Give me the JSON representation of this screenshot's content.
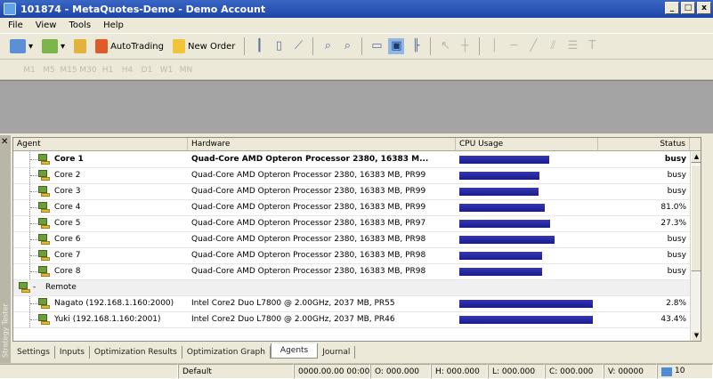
{
  "window": {
    "title": "101874 - MetaQuotes-Demo - Demo Account",
    "buttons": [
      "_",
      "□",
      "x"
    ]
  },
  "menu": [
    "File",
    "View",
    "Tools",
    "Help"
  ],
  "toolbar": {
    "autotrading_label": "AutoTrading",
    "new_order_label": "New Order"
  },
  "timeframes": [
    "M1",
    "M5",
    "M15",
    "M30",
    "H1",
    "H4",
    "D1",
    "W1",
    "MN"
  ],
  "tester": {
    "side_label": "Strategy Tester",
    "columns": {
      "agent": "Agent",
      "hardware": "Hardware",
      "cpu": "CPU Usage",
      "status": "Status"
    },
    "rows": [
      {
        "agent": "Core 1",
        "hardware": "Quad-Core AMD Opteron Processor 2380, 16383 M...",
        "cpu": 0.67,
        "status": "busy",
        "bold": true
      },
      {
        "agent": "Core 2",
        "hardware": "Quad-Core AMD Opteron Processor 2380, 16383 MB, PR99",
        "cpu": 0.6,
        "status": "busy"
      },
      {
        "agent": "Core 3",
        "hardware": "Quad-Core AMD Opteron Processor 2380, 16383 MB, PR99",
        "cpu": 0.59,
        "status": "busy"
      },
      {
        "agent": "Core 4",
        "hardware": "Quad-Core AMD Opteron Processor 2380, 16383 MB, PR99",
        "cpu": 0.64,
        "status": "81.0%"
      },
      {
        "agent": "Core 5",
        "hardware": "Quad-Core AMD Opteron Processor 2380, 16383 MB, PR97",
        "cpu": 0.68,
        "status": "27.3%"
      },
      {
        "agent": "Core 6",
        "hardware": "Quad-Core AMD Opteron Processor 2380, 16383 MB, PR98",
        "cpu": 0.71,
        "status": "busy"
      },
      {
        "agent": "Core 7",
        "hardware": "Quad-Core AMD Opteron Processor 2380, 16383 MB, PR98",
        "cpu": 0.62,
        "status": "busy"
      },
      {
        "agent": "Core 8",
        "hardware": "Quad-Core AMD Opteron Processor 2380, 16383 MB, PR98",
        "cpu": 0.62,
        "status": "busy"
      }
    ],
    "group_label": "Remote",
    "remote_rows": [
      {
        "agent": "Nagato (192.168.1.160:2000)",
        "hardware": "Intel Core2 Duo  L7800 @ 2.00GHz, 2037 MB, PR55",
        "cpu": 1.0,
        "status": "2.8%"
      },
      {
        "agent": "Yuki (192.168.1.160:2001)",
        "hardware": "Intel Core2 Duo  L7800 @ 2.00GHz, 2037 MB, PR46",
        "cpu": 1.0,
        "status": "43.4%"
      }
    ],
    "tabs": [
      "Settings",
      "Inputs",
      "Optimization Results",
      "Optimization Graph",
      "Agents",
      "Journal"
    ],
    "active_tab": "Agents"
  },
  "status": {
    "profile": "Default",
    "time": "0000.00.00 00:00",
    "open": "O: 000.000",
    "high": "H: 000.000",
    "low": "L: 000.000",
    "close": "C: 000.000",
    "volume": "V: 00000",
    "traffic": "10"
  }
}
